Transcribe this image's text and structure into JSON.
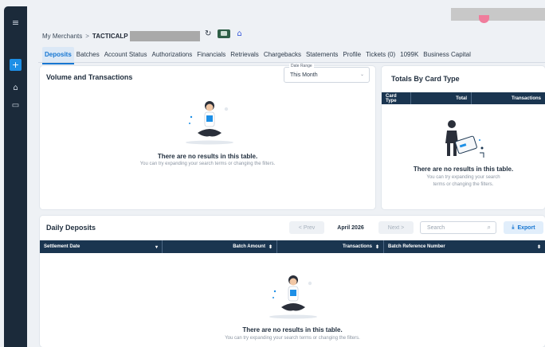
{
  "breadcrumb": {
    "root": "My Merchants",
    "separator": ">",
    "current": "TACTICALP"
  },
  "header_icons": [
    "refresh-icon",
    "cash-icon",
    "bank-icon"
  ],
  "tabs": [
    {
      "label": "Deposits",
      "active": true
    },
    {
      "label": "Batches"
    },
    {
      "label": "Account Status"
    },
    {
      "label": "Authorizations"
    },
    {
      "label": "Financials"
    },
    {
      "label": "Retrievals"
    },
    {
      "label": "Chargebacks"
    },
    {
      "label": "Statements"
    },
    {
      "label": "Profile"
    },
    {
      "label": "Tickets (0)"
    },
    {
      "label": "1099K"
    },
    {
      "label": "Business Capital"
    }
  ],
  "volume": {
    "title": "Volume and Transactions",
    "date_range_label": "Date Range",
    "date_range_value": "This Month",
    "empty_title": "There are no results in this table.",
    "empty_sub": "You can try expanding your search terms or changing the filters."
  },
  "totals": {
    "title": "Totals By Card Type",
    "columns": [
      "Card Type",
      "Total",
      "Transactions"
    ],
    "empty_title": "There are no results in this table.",
    "empty_sub_1": "You can try expanding your search",
    "empty_sub_2": "terms or changing the filters."
  },
  "daily": {
    "title": "Daily Deposits",
    "prev_label": "< Prev",
    "month": "April 2026",
    "next_label": "Next >",
    "search_placeholder": "Search",
    "export_label": "Export",
    "columns": [
      {
        "label": "Settlement Date",
        "mark": "▾"
      },
      {
        "label": "Batch Amount",
        "mark": "⬍"
      },
      {
        "label": "Transactions",
        "mark": "⬍"
      },
      {
        "label": "Batch Reference Number",
        "mark": "⬍"
      }
    ],
    "empty_title": "There are no results in this table.",
    "empty_sub": "You can try expanding your search terms or changing the filters."
  },
  "colors": {
    "accent": "#1676d2",
    "table_header": "#1a3550",
    "rail": "#1b2a3a"
  }
}
